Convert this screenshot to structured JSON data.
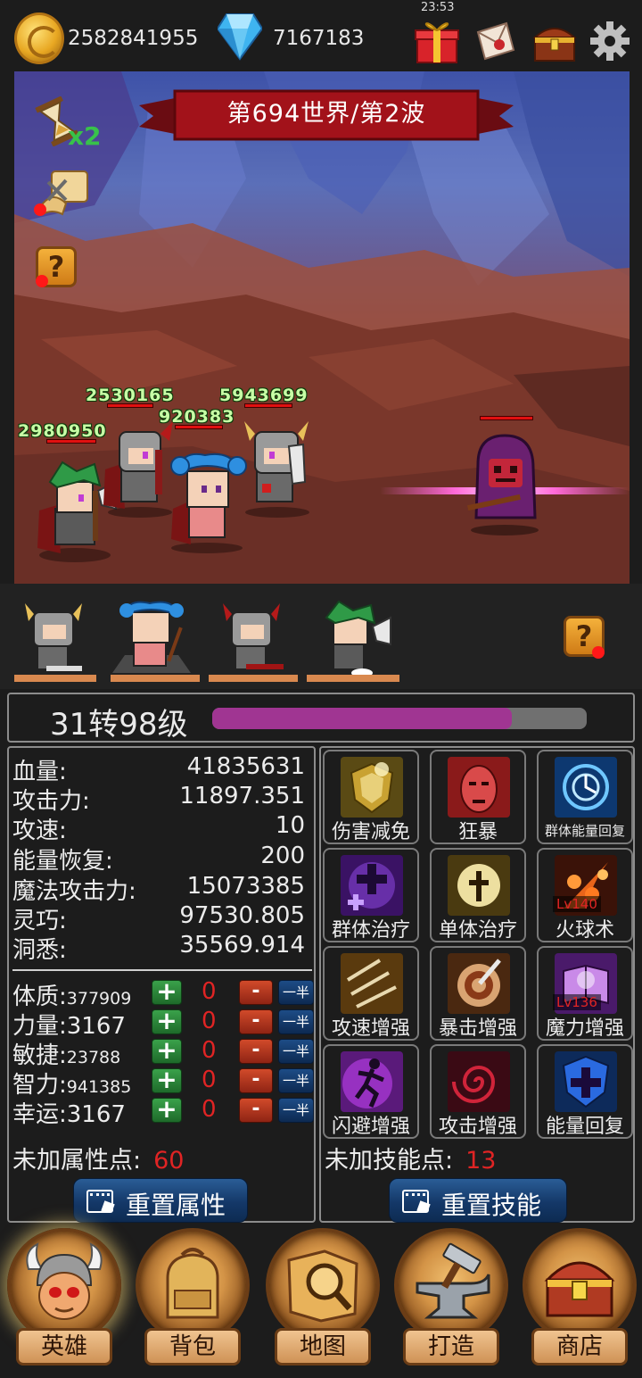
{
  "header": {
    "coins": "2582841955",
    "gems": "7167183",
    "clock": "23:53",
    "icons": [
      "coin-icon",
      "diamond-icon",
      "gift-box-icon",
      "letter-icon",
      "treasure-chest-icon",
      "gear-icon"
    ]
  },
  "battle": {
    "wave_banner": "第694世界/第2波",
    "speed_multiplier": "x2",
    "damage_numbers": [
      "2530165",
      "5943699",
      "920383",
      "2980950"
    ],
    "question_mark": "?"
  },
  "team": {
    "heroes": [
      "horned-knight",
      "blue-hair-mage",
      "red-horn-knight",
      "green-hair-axeman"
    ],
    "selected_index": 1,
    "question_mark": "?"
  },
  "level": {
    "label": "31转98级",
    "xp_progress": 0.8
  },
  "stats": [
    {
      "label": "血量:",
      "value": "41835631"
    },
    {
      "label": "攻击力:",
      "value": "11897.351"
    },
    {
      "label": "攻速:",
      "value": "10"
    },
    {
      "label": "能量恢复:",
      "value": "200"
    },
    {
      "label": "魔法攻击力:",
      "value": "15073385"
    },
    {
      "label": "灵巧:",
      "value": "97530.805"
    },
    {
      "label": "洞悉:",
      "value": "35569.914"
    }
  ],
  "attributes": [
    {
      "label": "体质:",
      "value": "377909",
      "pending": "0"
    },
    {
      "label": "力量:",
      "value": "3167",
      "pending": "0"
    },
    {
      "label": "敏捷:",
      "value": "23788",
      "pending": "0"
    },
    {
      "label": "智力:",
      "value": "941385",
      "pending": "0"
    },
    {
      "label": "幸运:",
      "value": "3167",
      "pending": "0"
    }
  ],
  "attr_buttons": {
    "plus": "+",
    "minus": "-",
    "half": "一半"
  },
  "unspent_attr": {
    "label": "未加属性点:",
    "value": "60"
  },
  "reset_attr_label": "重置属性",
  "skills": [
    {
      "name": "伤害减免",
      "level": ""
    },
    {
      "name": "狂暴",
      "level": ""
    },
    {
      "name": "群体能量回复",
      "level": ""
    },
    {
      "name": "群体治疗",
      "level": ""
    },
    {
      "name": "单体治疗",
      "level": ""
    },
    {
      "name": "火球术",
      "level": "Lv140"
    },
    {
      "name": "攻速增强",
      "level": ""
    },
    {
      "name": "暴击增强",
      "level": ""
    },
    {
      "name": "魔力增强",
      "level": "Lv136"
    },
    {
      "name": "闪避增强",
      "level": ""
    },
    {
      "name": "攻击增强",
      "level": ""
    },
    {
      "name": "能量回复",
      "level": ""
    }
  ],
  "unspent_skill": {
    "label": "未加技能点:",
    "value": "13"
  },
  "reset_skill_label": "重置技能",
  "nav": [
    {
      "label": "英雄",
      "active": true
    },
    {
      "label": "背包",
      "active": false
    },
    {
      "label": "地图",
      "active": false
    },
    {
      "label": "打造",
      "active": false
    },
    {
      "label": "商店",
      "active": false
    }
  ],
  "colors": {
    "accent_red": "#e02424",
    "xp_bar": "#a03592",
    "damage_text": "#c8ffa6",
    "banner_red": "#a2121a"
  }
}
